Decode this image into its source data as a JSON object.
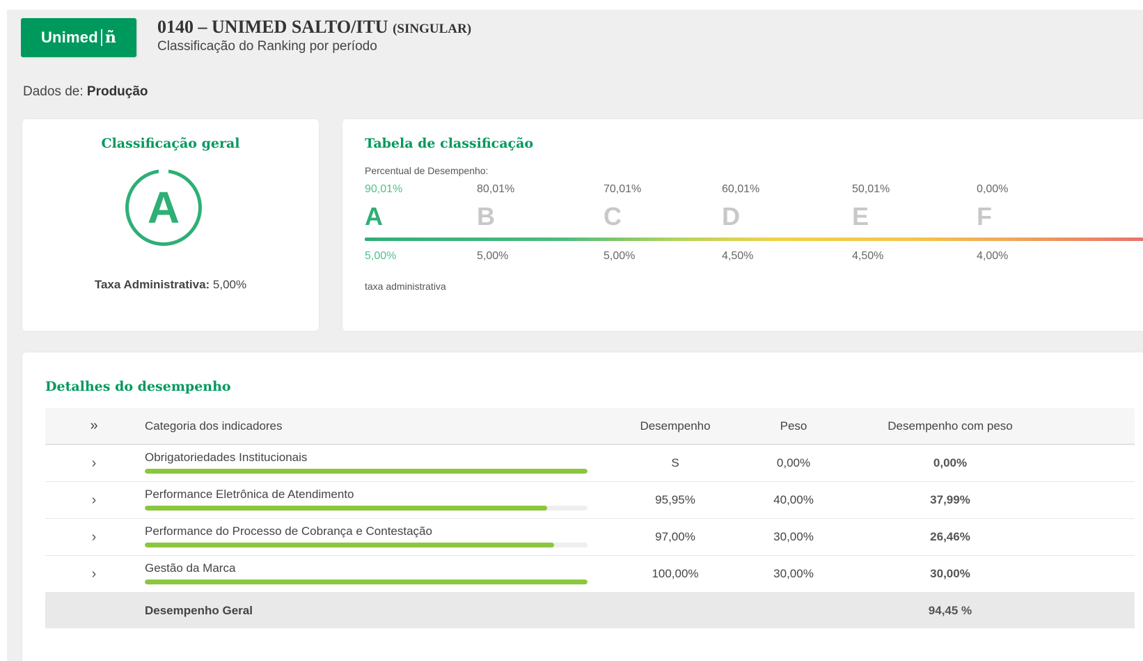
{
  "header": {
    "logo_text": "Unimed",
    "logo_mark": "ñ",
    "title_main": "0140 – UNIMED SALTO/ITU",
    "title_suffix": "(singular)",
    "subtitle": "Classificação do Ranking por período"
  },
  "dados": {
    "label": "Dados de:",
    "value": "Produção"
  },
  "classificacao_geral": {
    "title": "Classificação geral",
    "grade": "A",
    "taxa_label": "Taxa Administrativa:",
    "taxa_value": "5,00%"
  },
  "tabela": {
    "title": "Tabela de classificação",
    "percentual_label": "Percentual de Desempenho:",
    "taxa_label": "taxa administrativa",
    "grades": [
      {
        "percent": "90,01%",
        "letter": "A",
        "taxa": "5,00%"
      },
      {
        "percent": "80,01%",
        "letter": "B",
        "taxa": "5,00%"
      },
      {
        "percent": "70,01%",
        "letter": "C",
        "taxa": "5,00%"
      },
      {
        "percent": "60,01%",
        "letter": "D",
        "taxa": "4,50%"
      },
      {
        "percent": "50,01%",
        "letter": "E",
        "taxa": "4,50%"
      },
      {
        "percent": "0,00%",
        "letter": "F",
        "taxa": "4,00%"
      }
    ]
  },
  "detalhes": {
    "title": "Detalhes do desempenho",
    "expand_all_glyph": "»",
    "columns": {
      "categoria": "Categoria dos indicadores",
      "desempenho": "Desempenho",
      "peso": "Peso",
      "desempenho_peso": "Desempenho com peso"
    },
    "rows": [
      {
        "categoria": "Obrigatoriedades Institucionais",
        "desempenho": "S",
        "peso": "0,00%",
        "desempenho_peso": "0,00%",
        "progress": 1.0
      },
      {
        "categoria": "Performance Eletrônica de Atendimento",
        "desempenho": "95,95%",
        "peso": "40,00%",
        "desempenho_peso": "37,99%",
        "progress": 0.9095
      },
      {
        "categoria": "Performance do Processo de Cobrança e Contestação",
        "desempenho": "97,00%",
        "peso": "30,00%",
        "desempenho_peso": "26,46%",
        "progress": 0.925
      },
      {
        "categoria": "Gestão da Marca",
        "desempenho": "100,00%",
        "peso": "30,00%",
        "desempenho_peso": "30,00%",
        "progress": 1.0
      }
    ],
    "total": {
      "label": "Desempenho Geral",
      "value": "94,45 %"
    }
  },
  "colors": {
    "brand_green": "#00995d",
    "grade_green": "#2eaf75",
    "progress_green": "#8cc63f"
  }
}
